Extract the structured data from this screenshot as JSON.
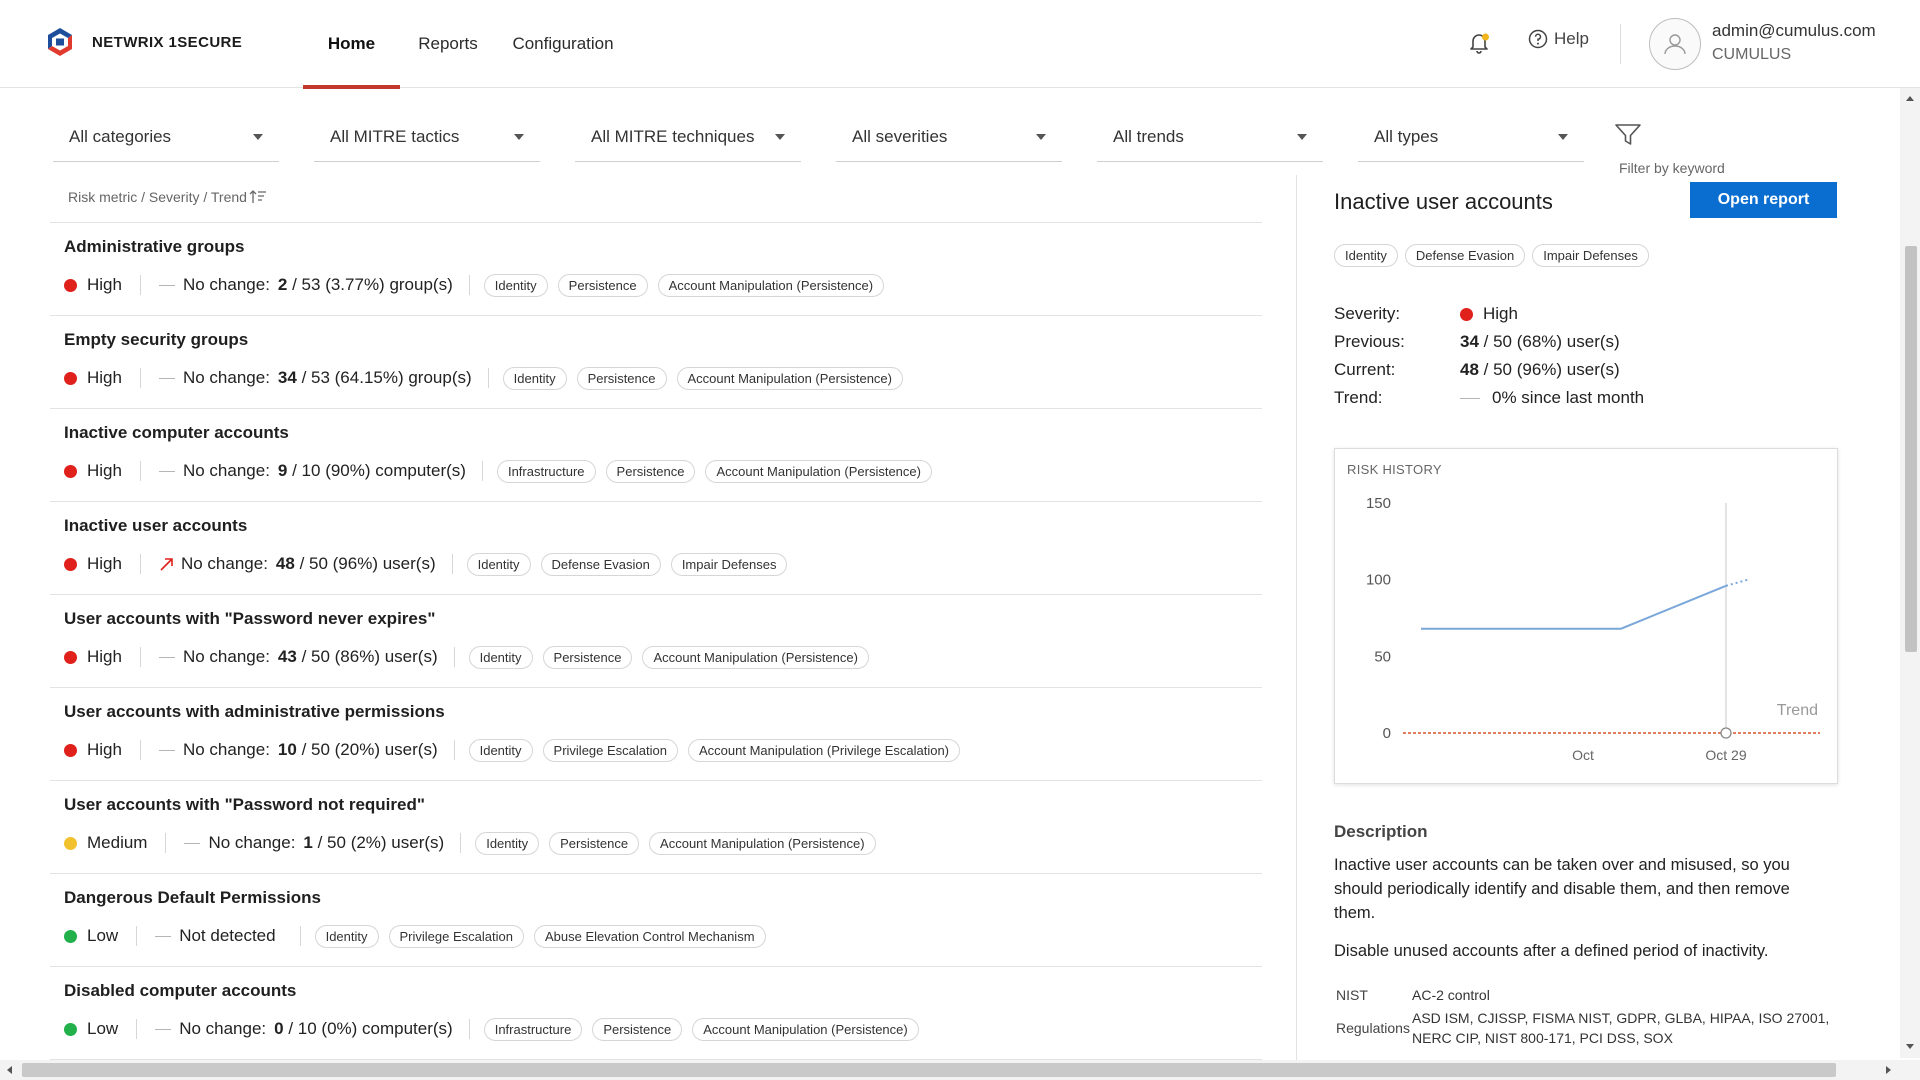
{
  "brand": {
    "name": "NETWRIX 1SECURE"
  },
  "nav": {
    "tabs": [
      {
        "label": "Home"
      },
      {
        "label": "Reports"
      },
      {
        "label": "Configuration"
      }
    ]
  },
  "header": {
    "help_label": "Help",
    "user_email": "admin@cumulus.com",
    "org": "CUMULUS"
  },
  "filters": {
    "items": [
      {
        "label": "All categories"
      },
      {
        "label": "All MITRE tactics"
      },
      {
        "label": "All MITRE techniques"
      },
      {
        "label": "All severities"
      },
      {
        "label": "All trends"
      },
      {
        "label": "All types"
      }
    ],
    "keyword_label": "Filter by keyword"
  },
  "list": {
    "header": "Risk metric / Severity / Trend",
    "rows": [
      {
        "title": "Administrative groups",
        "severity": "High",
        "severity_color": "#e0201b",
        "trend": "none",
        "trend_label": "No change:",
        "metric_value": "2",
        "metric_rest": " / 53 (3.77%) group(s)",
        "tags": [
          "Identity",
          "Persistence",
          "Account Manipulation (Persistence)"
        ]
      },
      {
        "title": "Empty security groups",
        "severity": "High",
        "severity_color": "#e0201b",
        "trend": "none",
        "trend_label": "No change:",
        "metric_value": "34",
        "metric_rest": " / 53 (64.15%) group(s)",
        "tags": [
          "Identity",
          "Persistence",
          "Account Manipulation (Persistence)"
        ]
      },
      {
        "title": "Inactive computer accounts",
        "severity": "High",
        "severity_color": "#e0201b",
        "trend": "none",
        "trend_label": "No change:",
        "metric_value": "9",
        "metric_rest": " / 10 (90%) computer(s)",
        "tags": [
          "Infrastructure",
          "Persistence",
          "Account Manipulation (Persistence)"
        ]
      },
      {
        "title": "Inactive user accounts",
        "severity": "High",
        "severity_color": "#e0201b",
        "trend": "up",
        "trend_label": "No change:",
        "metric_value": "48",
        "metric_rest": " / 50 (96%) user(s)",
        "tags": [
          "Identity",
          "Defense Evasion",
          "Impair Defenses"
        ]
      },
      {
        "title": "User accounts with \"Password never expires\"",
        "severity": "High",
        "severity_color": "#e0201b",
        "trend": "none",
        "trend_label": "No change:",
        "metric_value": "43",
        "metric_rest": " / 50 (86%) user(s)",
        "tags": [
          "Identity",
          "Persistence",
          "Account Manipulation (Persistence)"
        ]
      },
      {
        "title": "User accounts with administrative permissions",
        "severity": "High",
        "severity_color": "#e0201b",
        "trend": "none",
        "trend_label": "No change:",
        "metric_value": "10",
        "metric_rest": " / 50 (20%) user(s)",
        "tags": [
          "Identity",
          "Privilege Escalation",
          "Account Manipulation (Privilege Escalation)"
        ]
      },
      {
        "title": "User accounts with \"Password not required\"",
        "severity": "Medium",
        "severity_color": "#f2c12e",
        "trend": "none",
        "trend_label": "No change:",
        "metric_value": "1",
        "metric_rest": " / 50 (2%) user(s)",
        "tags": [
          "Identity",
          "Persistence",
          "Account Manipulation (Persistence)"
        ]
      },
      {
        "title": "Dangerous Default Permissions",
        "severity": "Low",
        "severity_color": "#22b04b",
        "trend": "none",
        "trend_label": "Not detected",
        "metric_value": "",
        "metric_rest": "",
        "tags": [
          "Identity",
          "Privilege Escalation",
          "Abuse Elevation Control Mechanism"
        ]
      },
      {
        "title": "Disabled computer accounts",
        "severity": "Low",
        "severity_color": "#22b04b",
        "trend": "none",
        "trend_label": "No change:",
        "metric_value": "0",
        "metric_rest": " / 10 (0%) computer(s)",
        "tags": [
          "Infrastructure",
          "Persistence",
          "Account Manipulation (Persistence)"
        ]
      }
    ]
  },
  "detail": {
    "title": "Inactive user accounts",
    "open_report_label": "Open report",
    "tags": [
      "Identity",
      "Defense Evasion",
      "Impair Defenses"
    ],
    "severity_label": "Severity:",
    "severity": "High",
    "severity_color": "#e0201b",
    "previous_label": "Previous:",
    "previous_value": "34",
    "previous_rest": " / 50 (68%) user(s)",
    "current_label": "Current:",
    "current_value": "48",
    "current_rest": " / 50 (96%) user(s)",
    "trend_label": "Trend:",
    "trend_value": "0% since last month",
    "description_heading": "Description",
    "description_p1": "Inactive user accounts can be taken over and misused, so you should periodically identify and disable them, and then remove them.",
    "description_p2": "Disable unused accounts after a defined period of inactivity.",
    "nist_label": "NIST",
    "nist_value": "AC-2 control",
    "regulations_label": "Regulations",
    "regulations_value": "ASD ISM, CJISSP, FISMA NIST, GDPR, GLBA, HIPAA, ISO 27001, NERC CIP, NIST 800-171, PCI DSS, SOX"
  },
  "chart_data": {
    "type": "line",
    "title": "RISK HISTORY",
    "ylim": [
      0,
      150
    ],
    "yticks": [
      0,
      50,
      100,
      150
    ],
    "xticks": [
      "Oct",
      "Oct 29"
    ],
    "trend_label": "Trend",
    "series": [
      {
        "points": [
          {
            "x": "start",
            "y": 68
          },
          {
            "x": "mid",
            "y": 68
          },
          {
            "x": "Oct 29",
            "y": 96
          }
        ],
        "color": "#7aa7d9"
      }
    ],
    "baseline": {
      "y": 0,
      "color": "#d9542a"
    }
  },
  "colors": {
    "accent": "#c0392b",
    "primary_button": "#0a6ed1"
  },
  "icons": {
    "notifications": "bell-icon",
    "help": "help-circle-icon",
    "filter": "funnel-icon",
    "sort": "sort-icon",
    "user": "user-avatar-icon"
  }
}
